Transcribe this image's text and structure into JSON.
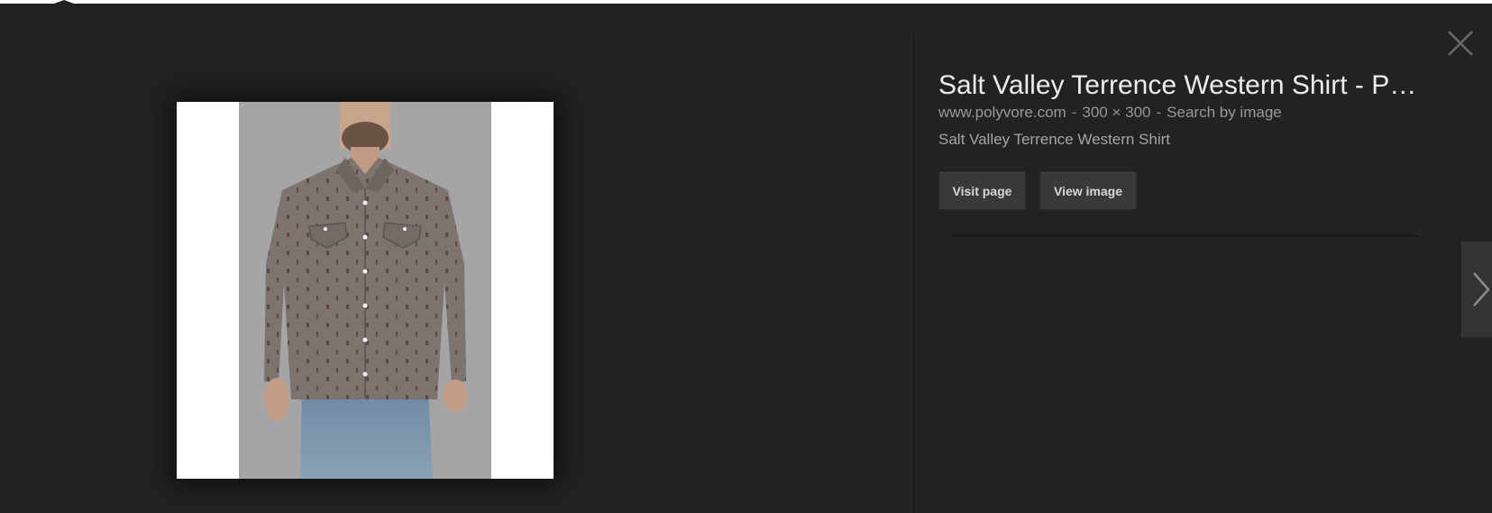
{
  "result": {
    "title": "Salt Valley Terrence Western Shirt - P…",
    "source": "www.polyvore.com",
    "dimensions": "300 × 300",
    "search_by_image": "Search by image",
    "description": "Salt Valley Terrence Western Shirt",
    "separator": "-"
  },
  "actions": {
    "visit_page": "Visit page",
    "view_image": "View image"
  },
  "icons": {
    "close": "close-icon",
    "next": "chevron-right-icon"
  },
  "colors": {
    "panel_background": "#222222",
    "title_text": "#ececec",
    "meta_text": "#969696",
    "button_background": "#393939"
  }
}
